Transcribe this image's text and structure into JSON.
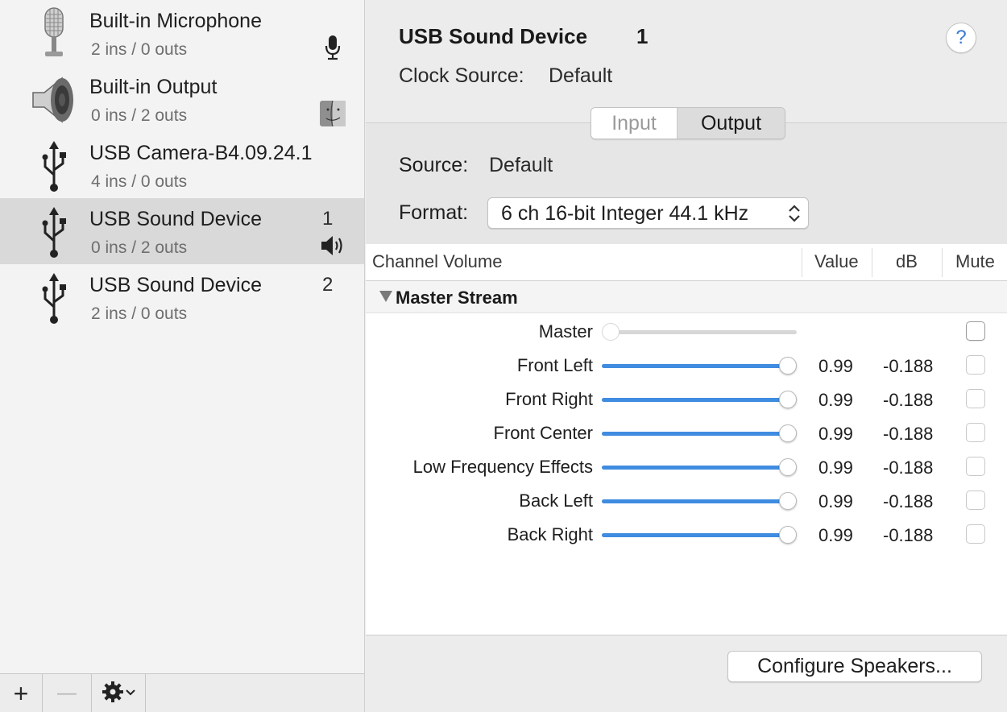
{
  "devices": [
    {
      "name": "Built-in Microphone",
      "io": "2 ins / 0 outs",
      "number": "",
      "icon": "microphone-icon",
      "status_icon": "mic-icon"
    },
    {
      "name": "Built-in Output",
      "io": "0 ins / 2 outs",
      "number": "",
      "icon": "speaker-icon",
      "status_icon": "finder-icon"
    },
    {
      "name": "USB Camera-B4.09.24.1",
      "io": "4 ins / 0 outs",
      "number": "",
      "icon": "usb-icon",
      "status_icon": ""
    },
    {
      "name": "USB Sound Device",
      "io": "0 ins / 2 outs",
      "number": "1",
      "icon": "usb-icon",
      "status_icon": "volume-icon",
      "selected": true
    },
    {
      "name": "USB Sound Device",
      "io": "2 ins / 0 outs",
      "number": "2",
      "icon": "usb-icon",
      "status_icon": ""
    }
  ],
  "toolbar": {
    "add_label": "+",
    "remove_label": "—"
  },
  "detail": {
    "device_title": "USB Sound Device",
    "device_number": "1",
    "clock_label": "Clock Source:",
    "clock_value": "Default",
    "help_label": "?",
    "tabs": [
      {
        "label": "Input",
        "selected": false
      },
      {
        "label": "Output",
        "selected": true
      }
    ],
    "source_label": "Source:",
    "source_value": "Default",
    "format_label": "Format:",
    "format_value": "6 ch 16-bit Integer 44.1 kHz",
    "table": {
      "columns": [
        "Channel Volume",
        "Value",
        "dB",
        "Mute"
      ],
      "group": "Master Stream",
      "rows": [
        {
          "label": "Master",
          "value": "",
          "db": "",
          "level": 0.0,
          "enabled": false
        },
        {
          "label": "Front Left",
          "value": "0.99",
          "db": "-0.188",
          "level": 0.99,
          "enabled": true
        },
        {
          "label": "Front Right",
          "value": "0.99",
          "db": "-0.188",
          "level": 0.99,
          "enabled": true
        },
        {
          "label": "Front Center",
          "value": "0.99",
          "db": "-0.188",
          "level": 0.99,
          "enabled": true
        },
        {
          "label": "Low Frequency Effects",
          "value": "0.99",
          "db": "-0.188",
          "level": 0.99,
          "enabled": true
        },
        {
          "label": "Back Left",
          "value": "0.99",
          "db": "-0.188",
          "level": 0.99,
          "enabled": true
        },
        {
          "label": "Back Right",
          "value": "0.99",
          "db": "-0.188",
          "level": 0.99,
          "enabled": true
        }
      ]
    },
    "configure_label": "Configure Speakers..."
  },
  "colors": {
    "accent": "#3f8ce0",
    "selected_row": "#d9d9d9"
  }
}
